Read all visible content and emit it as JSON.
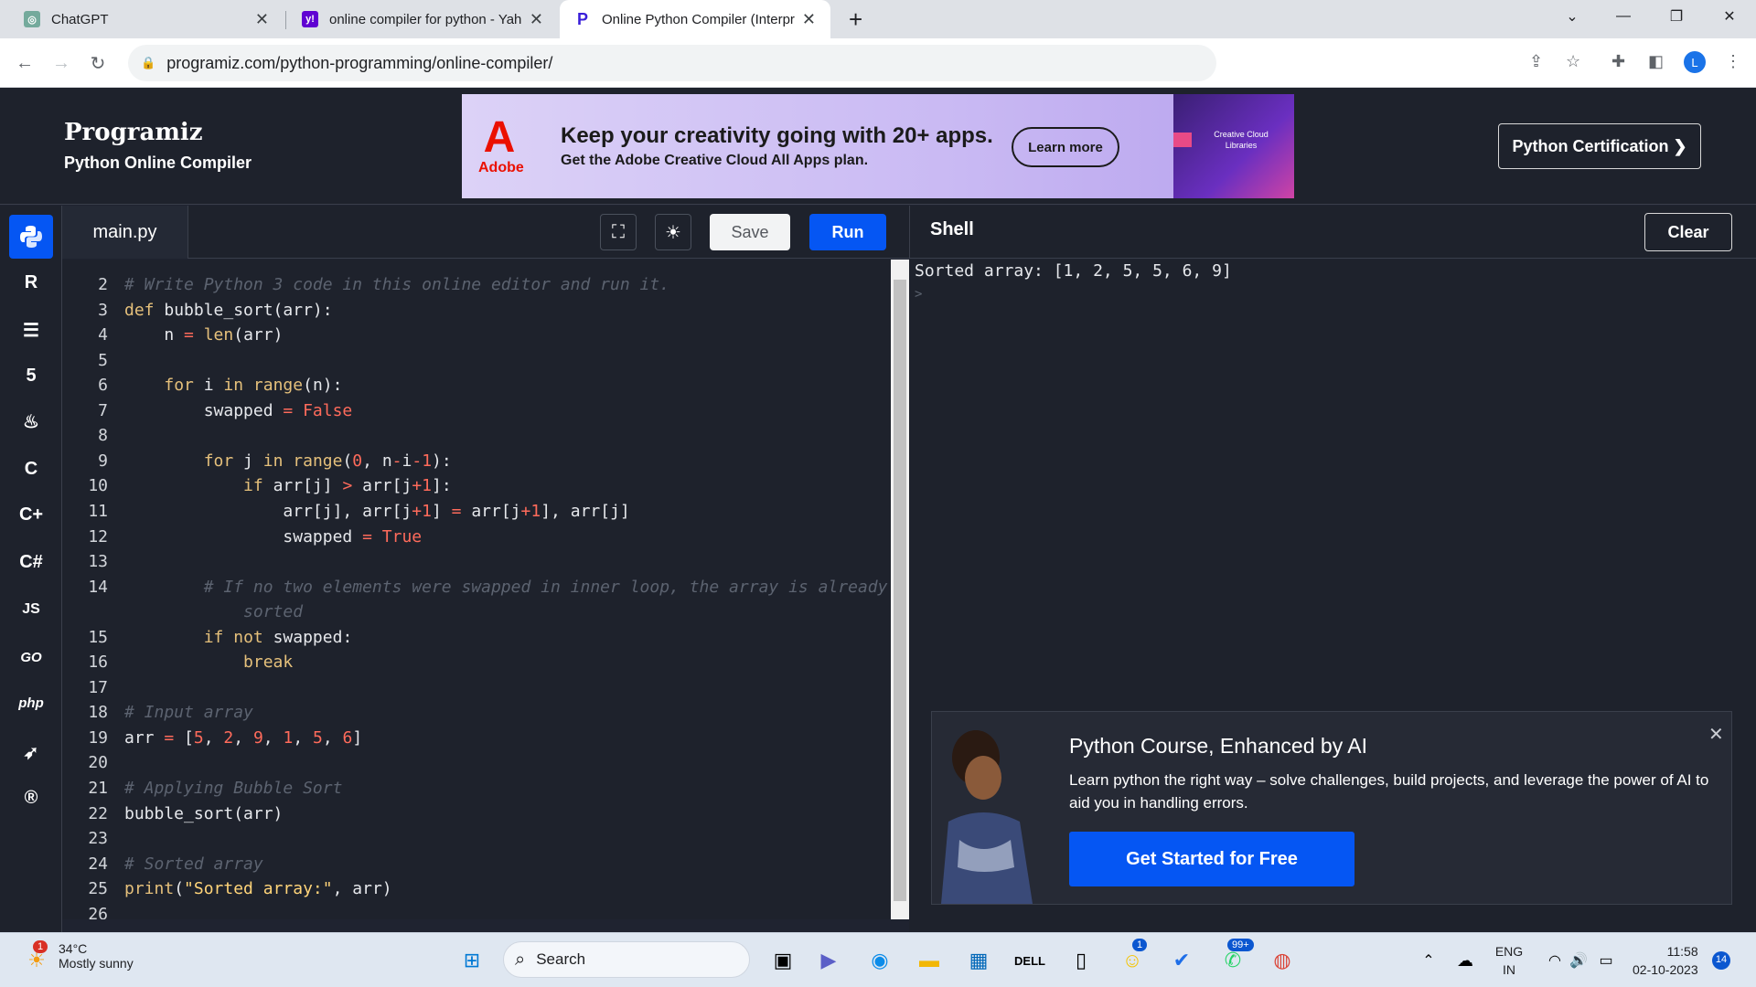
{
  "browser": {
    "tabs": [
      {
        "title": "ChatGPT"
      },
      {
        "title": "online compiler for python - Yah"
      },
      {
        "title": "Online Python Compiler (Interpr"
      }
    ],
    "url": "programiz.com/python-programming/online-compiler/",
    "profile_initial": "L"
  },
  "site": {
    "logo": "Programiz",
    "subtitle": "Python Online Compiler",
    "cert_button": "Python Certification ❯"
  },
  "ad": {
    "brand": "Adobe",
    "headline": "Keep your creativity going with 20+ apps.",
    "subline": "Get the Adobe Creative Cloud All Apps plan.",
    "cta": "Learn more",
    "side_text": "Creative Cloud Libraries"
  },
  "sidebar": {
    "items": [
      "python",
      "r",
      "sql",
      "html5",
      "java",
      "c",
      "cpp",
      "csharp",
      "JS",
      "GO",
      "php",
      "swift",
      "rust"
    ]
  },
  "editor": {
    "file_tab": "main.py",
    "save_label": "Save",
    "run_label": "Run",
    "lines": [
      {
        "n": "2",
        "html": "<span class='cmt'># Write Python 3 code in this online editor and run it.</span>"
      },
      {
        "n": "3",
        "html": "<span class='kw'>def</span> bubble_sort(arr):"
      },
      {
        "n": "4",
        "html": "    n <span class='op'>=</span> <span class='kw'>len</span>(arr)"
      },
      {
        "n": "5",
        "html": ""
      },
      {
        "n": "6",
        "html": "    <span class='kw'>for</span> i <span class='kw'>in</span> <span class='kw'>range</span>(n):"
      },
      {
        "n": "7",
        "html": "        swapped <span class='op'>=</span> <span class='nm'>False</span>"
      },
      {
        "n": "8",
        "html": ""
      },
      {
        "n": "9",
        "html": "        <span class='kw'>for</span> j <span class='kw'>in</span> <span class='kw'>range</span>(<span class='nm'>0</span>, n<span class='op'>-</span>i<span class='op'>-</span><span class='nm'>1</span>):"
      },
      {
        "n": "10",
        "html": "            <span class='kw'>if</span> arr[j] <span class='op'>&gt;</span> arr[j<span class='op'>+</span><span class='nm'>1</span>]:"
      },
      {
        "n": "11",
        "html": "                arr[j], arr[j<span class='op'>+</span><span class='nm'>1</span>] <span class='op'>=</span> arr[j<span class='op'>+</span><span class='nm'>1</span>], arr[j]"
      },
      {
        "n": "12",
        "html": "                swapped <span class='op'>=</span> <span class='nm'>True</span>"
      },
      {
        "n": "13",
        "html": ""
      },
      {
        "n": "14",
        "html": "        <span class='cmt'># If no two elements were swapped in inner loop, the array is already</span>"
      },
      {
        "n": "",
        "html": "            <span class='cmt'>sorted</span>"
      },
      {
        "n": "15",
        "html": "        <span class='kw'>if</span> <span class='kw'>not</span> swapped:"
      },
      {
        "n": "16",
        "html": "            <span class='kw'>break</span>"
      },
      {
        "n": "17",
        "html": ""
      },
      {
        "n": "18",
        "html": "<span class='cmt'># Input array</span>"
      },
      {
        "n": "19",
        "html": "arr <span class='op'>=</span> [<span class='nm'>5</span>, <span class='nm'>2</span>, <span class='nm'>9</span>, <span class='nm'>1</span>, <span class='nm'>5</span>, <span class='nm'>6</span>]"
      },
      {
        "n": "20",
        "html": ""
      },
      {
        "n": "21",
        "html": "<span class='cmt'># Applying Bubble Sort</span>"
      },
      {
        "n": "22",
        "html": "bubble_sort(arr)"
      },
      {
        "n": "23",
        "html": ""
      },
      {
        "n": "24",
        "html": "<span class='cmt'># Sorted array</span>"
      },
      {
        "n": "25",
        "html": "<span class='kw'>print</span>(<span class='st'>\"Sorted array:\"</span>, arr)"
      },
      {
        "n": "26",
        "html": ""
      }
    ]
  },
  "shell": {
    "title": "Shell",
    "clear_label": "Clear",
    "output": "Sorted array: [1, 2, 5, 5, 6, 9]",
    "prompt": ">"
  },
  "promo": {
    "title": "Python Course, Enhanced by AI",
    "description": "Learn python the right way – solve challenges, build projects, and leverage the power of AI to aid you in handling errors.",
    "cta": "Get Started for Free"
  },
  "taskbar": {
    "weather_temp": "34°C",
    "weather_desc": "Mostly sunny",
    "weather_badge": "1",
    "search_placeholder": "Search",
    "snap_badge": "1",
    "whatsapp_badge": "99+",
    "lang": "ENG",
    "region": "IN",
    "time": "11:58",
    "date": "02-10-2023",
    "notif_count": "14"
  },
  "colors": {
    "accent": "#0556f3",
    "bg": "#1e222c",
    "keyword": "#e5c07b",
    "number": "#ff6b5b"
  }
}
